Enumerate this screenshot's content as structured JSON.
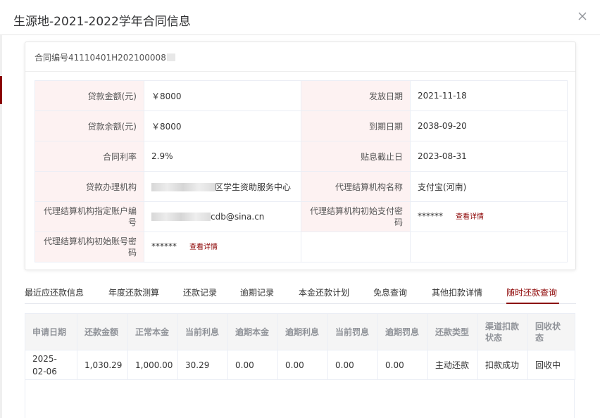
{
  "dialog": {
    "title": "生源地-2021-2022学年合同信息",
    "close_icon": "close-icon"
  },
  "contract": {
    "number_label": "合同编号",
    "number_visible": "41110401H202100008"
  },
  "info_rows": [
    {
      "left_label": "贷款金额(元)",
      "left_value": "￥8000",
      "right_label": "发放日期",
      "right_value": "2021-11-18"
    },
    {
      "left_label": "贷款余额(元)",
      "left_value": "￥8000",
      "right_label": "到期日期",
      "right_value": "2038-09-20"
    },
    {
      "left_label": "合同利率",
      "left_value": "2.9%",
      "right_label": "贴息截止日",
      "right_value": "2023-08-31"
    },
    {
      "left_label": "贷款办理机构",
      "left_value": "区学生资助服务中心",
      "right_label": "代理结算机构名称",
      "right_value": "支付宝(河南)"
    },
    {
      "left_label": "代理结算机构指定账户编号",
      "left_value": "cdb@sina.cn",
      "right_label": "代理结算机构初始支付密码",
      "right_value": "******",
      "right_link": "查看详情"
    },
    {
      "left_label": "代理结算机构初始账号密码",
      "left_value": "******",
      "left_link": "查看详情"
    }
  ],
  "tabs": [
    "最近应还款信息",
    "年度还款测算",
    "还款记录",
    "逾期记录",
    "本金还款计划",
    "免息查询",
    "其他扣款详情",
    "随时还款查询"
  ],
  "active_tab": "随时还款查询",
  "table": {
    "headers": [
      "申请日期",
      "还款金额",
      "正常本金",
      "当前利息",
      "逾期本金",
      "逾期利息",
      "当前罚息",
      "逾期罚息",
      "还款类型",
      "渠道扣款状态",
      "回收状态"
    ],
    "rows": [
      [
        "2025-02-06",
        "1,030.29",
        "1,000.00",
        "30.29",
        "0.00",
        "0.00",
        "0.00",
        "0.00",
        "主动还款",
        "扣款成功",
        "回收中"
      ]
    ]
  },
  "colors": {
    "accent": "#8b0000",
    "label_bg": "#fdf2f2",
    "header_bg": "#f5f5f5",
    "border": "#ebeef5"
  }
}
